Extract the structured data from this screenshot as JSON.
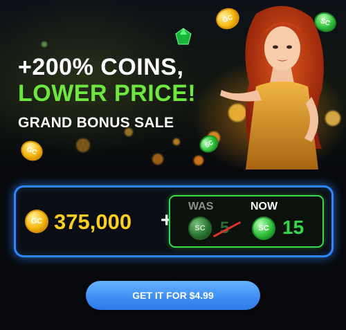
{
  "banner": {
    "headline_line1": "+200% COINS,",
    "headline_line2": "LOWER PRICE!",
    "subheadline": "GRAND BONUS SALE"
  },
  "offer": {
    "gold_coin_icon_text": "GC",
    "gold_coin_amount": "375,000",
    "plus_sign": "+",
    "was_label": "WAS",
    "was_coin_icon_text": "SC",
    "was_value": "5",
    "now_label": "NOW",
    "now_coin_icon_text": "SC",
    "now_value": "15"
  },
  "cta": {
    "label": "GET IT FOR $4.99"
  },
  "colors": {
    "accent_green": "#6ee83f",
    "gold": "#ffcf1d",
    "frame_blue": "#2f86ff",
    "frame_green": "#38d84a",
    "button_blue": "#3d8cf5"
  }
}
